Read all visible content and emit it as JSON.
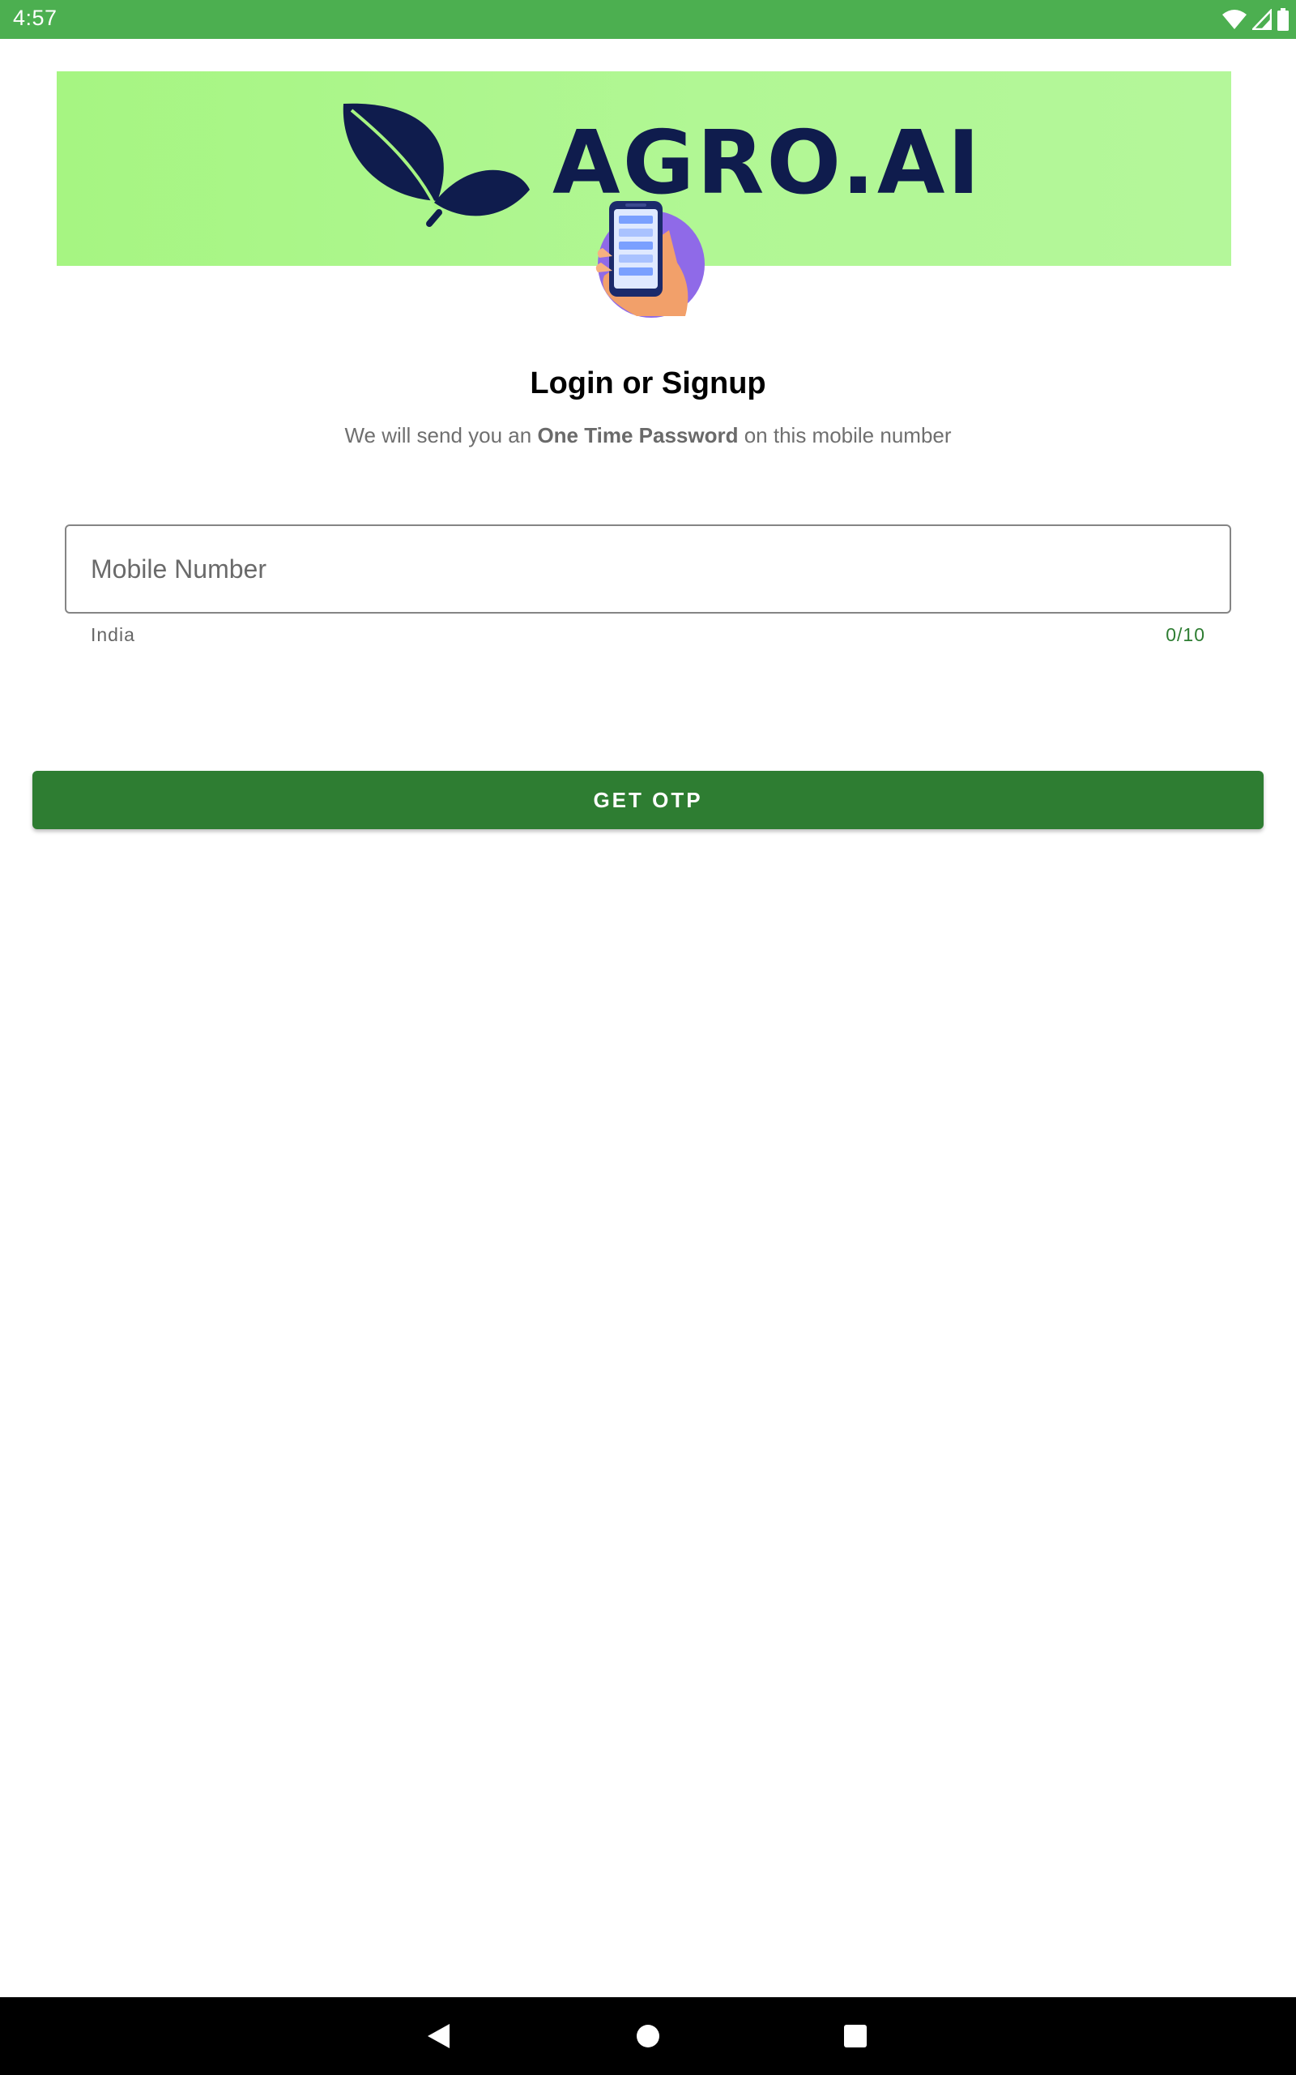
{
  "status_bar": {
    "time": "4:57",
    "icons": [
      "wifi-icon",
      "signal-icon",
      "battery-icon"
    ]
  },
  "banner": {
    "brand": "AGRO.AI",
    "logo_icon": "leaf-icon",
    "background_color": "#a6f582",
    "brand_color": "#0f1c4d"
  },
  "illustration": {
    "icon": "phone-in-hand-icon"
  },
  "login": {
    "title": "Login or Signup",
    "subtitle_before": "We will send you an ",
    "subtitle_bold": "One Time Password",
    "subtitle_after": " on this mobile number"
  },
  "mobile_field": {
    "placeholder": "Mobile Number",
    "value": "",
    "helper": "India",
    "counter": "0/10"
  },
  "primary_button": {
    "label": "GET OTP",
    "color": "#2e7d32"
  },
  "nav_bar": {
    "buttons": [
      "back-icon",
      "home-icon",
      "recents-icon"
    ]
  },
  "colors": {
    "status_bar": "#4caf50",
    "accent": "#2e7d32"
  }
}
